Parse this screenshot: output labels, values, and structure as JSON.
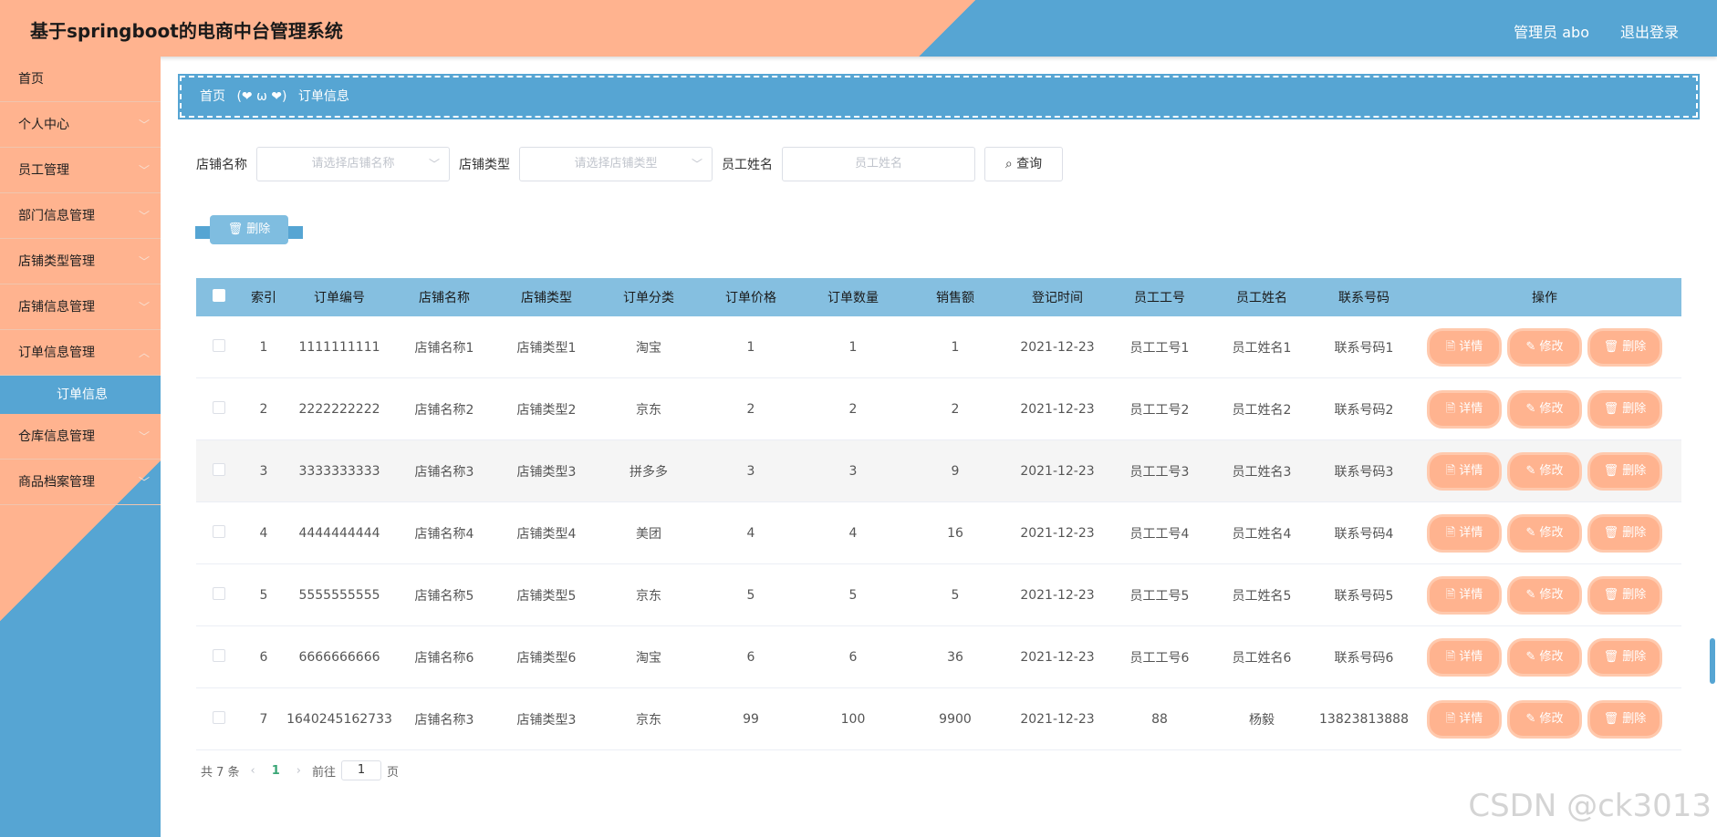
{
  "header": {
    "title": "基于springboot的电商中台管理系统",
    "admin": "管理员 abo",
    "logout": "退出登录"
  },
  "sidebar": {
    "items": [
      {
        "label": "首页",
        "chev": ""
      },
      {
        "label": "个人中心",
        "chev": "﹀"
      },
      {
        "label": "员工管理",
        "chev": "﹀"
      },
      {
        "label": "部门信息管理",
        "chev": "﹀"
      },
      {
        "label": "店铺类型管理",
        "chev": "﹀"
      },
      {
        "label": "店铺信息管理",
        "chev": "﹀"
      },
      {
        "label": "订单信息管理",
        "chev": "︿"
      },
      {
        "label": "订单信息",
        "chev": ""
      },
      {
        "label": "仓库信息管理",
        "chev": "﹀"
      },
      {
        "label": "商品档案管理",
        "chev": "﹀"
      }
    ]
  },
  "breadcrumb": {
    "home": "首页",
    "sep": "(❤ ω ❤)",
    "current": "订单信息"
  },
  "search": {
    "shop_label": "店铺名称",
    "shop_placeholder": "请选择店铺名称",
    "type_label": "店铺类型",
    "type_placeholder": "请选择店铺类型",
    "emp_label": "员工姓名",
    "emp_placeholder": "员工姓名",
    "query_label": "⌕ 查询"
  },
  "toolbar": {
    "delete_label": "🗑 删除"
  },
  "table": {
    "headers": [
      "索引",
      "订单编号",
      "店铺名称",
      "店铺类型",
      "订单分类",
      "订单价格",
      "订单数量",
      "销售额",
      "登记时间",
      "员工工号",
      "员工姓名",
      "联系号码",
      "操作"
    ],
    "rows": [
      [
        "1",
        "1111111111",
        "店铺名称1",
        "店铺类型1",
        "淘宝",
        "1",
        "1",
        "1",
        "2021-12-23",
        "员工工号1",
        "员工姓名1",
        "联系号码1"
      ],
      [
        "2",
        "2222222222",
        "店铺名称2",
        "店铺类型2",
        "京东",
        "2",
        "2",
        "2",
        "2021-12-23",
        "员工工号2",
        "员工姓名2",
        "联系号码2"
      ],
      [
        "3",
        "3333333333",
        "店铺名称3",
        "店铺类型3",
        "拼多多",
        "3",
        "3",
        "9",
        "2021-12-23",
        "员工工号3",
        "员工姓名3",
        "联系号码3"
      ],
      [
        "4",
        "4444444444",
        "店铺名称4",
        "店铺类型4",
        "美团",
        "4",
        "4",
        "16",
        "2021-12-23",
        "员工工号4",
        "员工姓名4",
        "联系号码4"
      ],
      [
        "5",
        "5555555555",
        "店铺名称5",
        "店铺类型5",
        "京东",
        "5",
        "5",
        "5",
        "2021-12-23",
        "员工工号5",
        "员工姓名5",
        "联系号码5"
      ],
      [
        "6",
        "6666666666",
        "店铺名称6",
        "店铺类型6",
        "淘宝",
        "6",
        "6",
        "36",
        "2021-12-23",
        "员工工号6",
        "员工姓名6",
        "联系号码6"
      ],
      [
        "7",
        "1640245162733",
        "店铺名称3",
        "店铺类型3",
        "京东",
        "99",
        "100",
        "9900",
        "2021-12-23",
        "88",
        "杨毅",
        "13823813888"
      ]
    ],
    "ops": {
      "detail": "🗎 详情",
      "edit": "✎ 修改",
      "delete": "🗑 删除"
    }
  },
  "pager": {
    "total": "共 7 条",
    "prev": "‹",
    "current": "1",
    "next": "›",
    "goto": "前往",
    "page_value": "1",
    "page_unit": "页"
  },
  "watermark": "CSDN @ck3013"
}
